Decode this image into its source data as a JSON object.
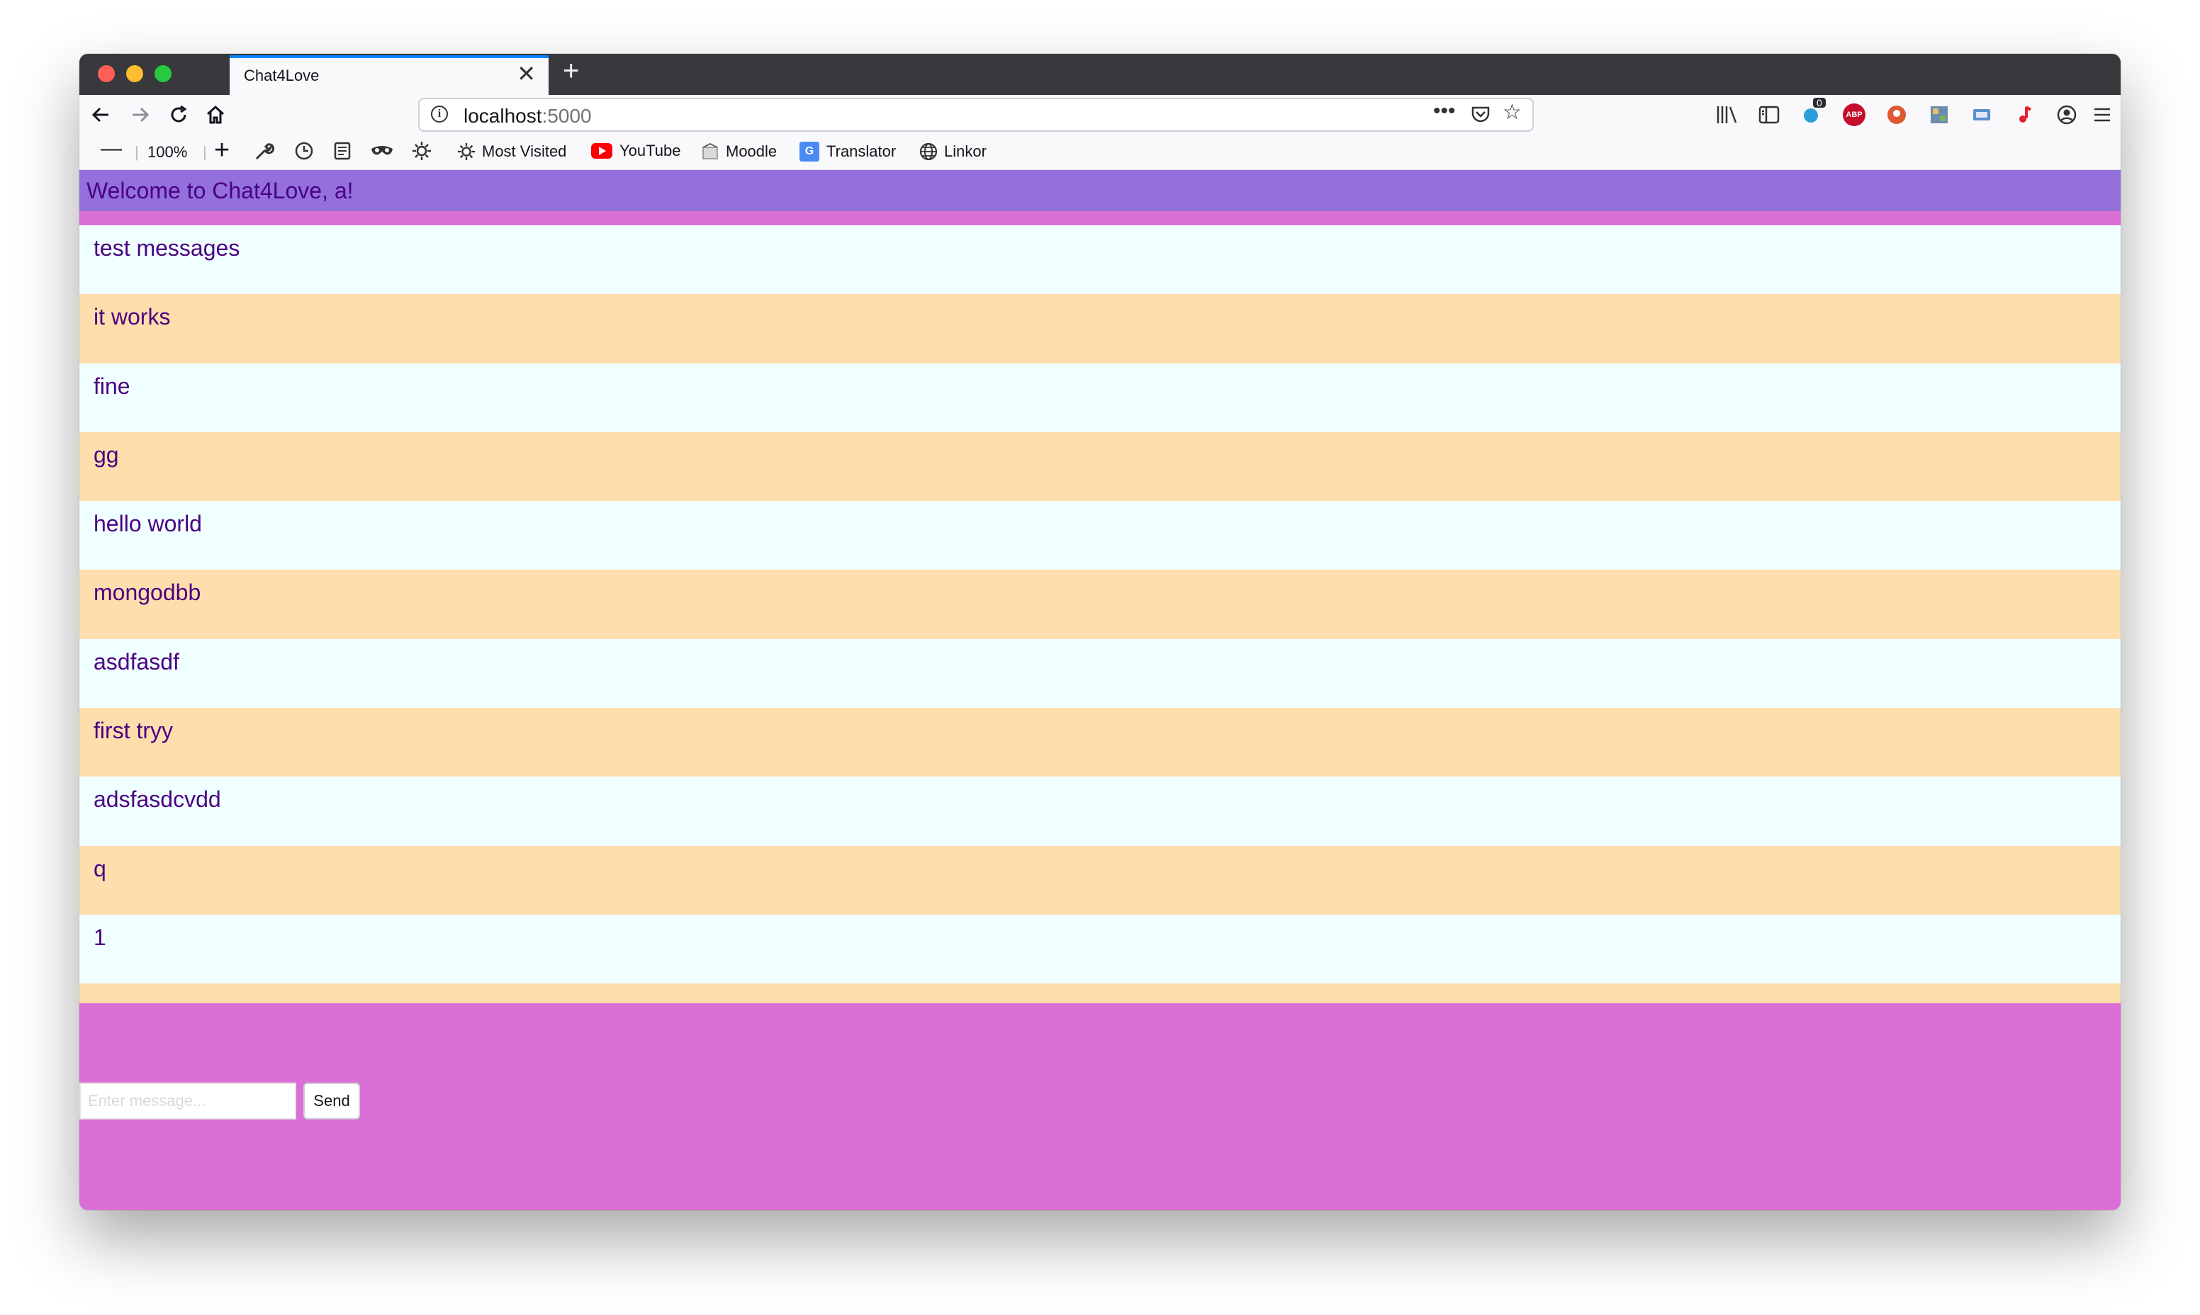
{
  "browser": {
    "tab_title": "Chat4Love",
    "tab_close": "✕",
    "new_tab": "+",
    "url_host": "localhost",
    "url_port": ":5000",
    "zoom_level": "100%",
    "zoom_out": "—",
    "zoom_in": "+",
    "extension_badge_count": "0",
    "abp_label": "ABP",
    "bookmarks": [
      {
        "label": "Most Visited",
        "icon": "gear-icon"
      },
      {
        "label": "YouTube",
        "icon": "youtube-icon"
      },
      {
        "label": "Moodle",
        "icon": "moodle-icon"
      },
      {
        "label": "Translator",
        "icon": "translator-icon"
      },
      {
        "label": "Linkor",
        "icon": "globe-icon"
      }
    ]
  },
  "app": {
    "welcome_text": "Welcome to Chat4Love, a!",
    "messages": [
      "test messages",
      "it works",
      "fine",
      "gg",
      "hello world",
      "mongodbb",
      "asdfasdf",
      "first tryy",
      "adsfasdcvdd",
      "q",
      "1",
      ""
    ],
    "input_placeholder": "Enter message...",
    "send_label": "Send"
  },
  "colors": {
    "header_bg": "#9370db",
    "page_bg": "#da70d6",
    "message_odd_bg": "#f0ffff",
    "message_even_bg": "#ffdead",
    "text_color": "#4b0082"
  }
}
